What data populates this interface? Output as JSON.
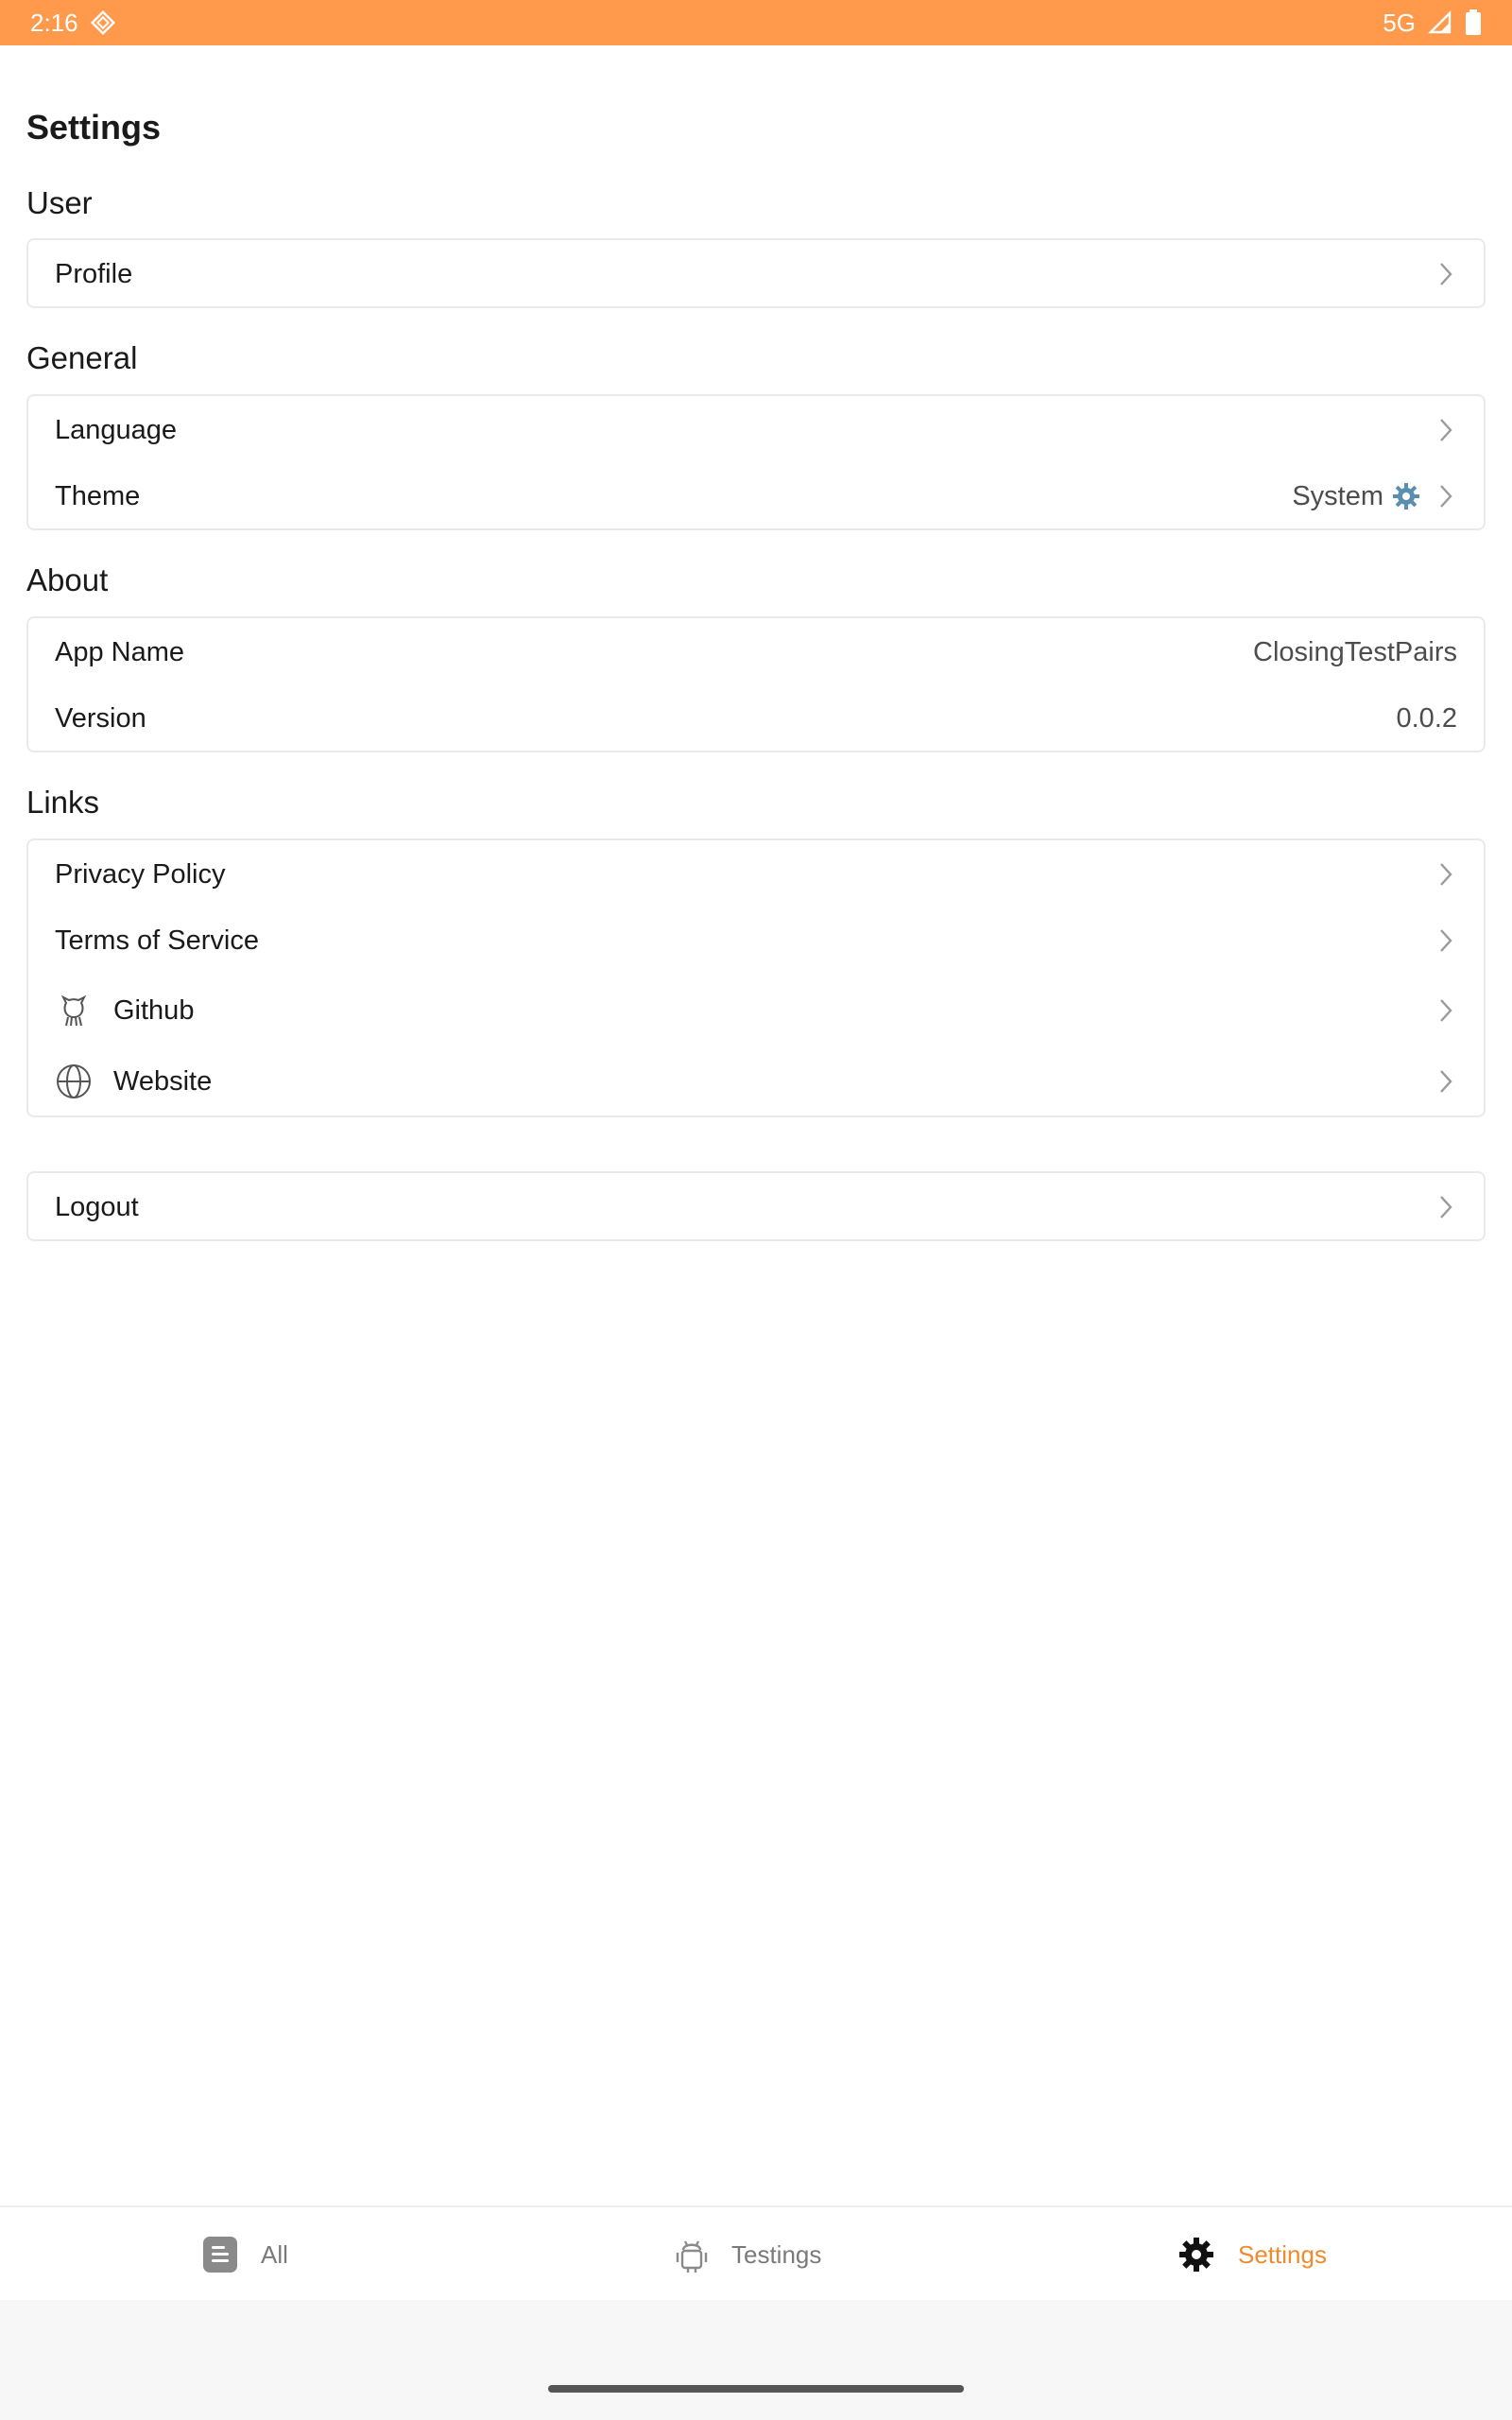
{
  "status_bar": {
    "time": "2:16",
    "network": "5G"
  },
  "page": {
    "title": "Settings"
  },
  "sections": {
    "user": {
      "title": "User",
      "items": [
        {
          "label": "Profile"
        }
      ]
    },
    "general": {
      "title": "General",
      "items": [
        {
          "label": "Language"
        },
        {
          "label": "Theme",
          "value": "System"
        }
      ]
    },
    "about": {
      "title": "About",
      "items": [
        {
          "label": "App Name",
          "value": "ClosingTestPairs"
        },
        {
          "label": "Version",
          "value": "0.0.2"
        }
      ]
    },
    "links": {
      "title": "Links",
      "items": [
        {
          "label": "Privacy Policy"
        },
        {
          "label": "Terms of Service"
        },
        {
          "label": "Github",
          "icon": "github-icon"
        },
        {
          "label": "Website",
          "icon": "globe-icon"
        }
      ]
    },
    "logout": {
      "items": [
        {
          "label": "Logout"
        }
      ]
    }
  },
  "bottom_nav": {
    "items": [
      {
        "label": "All",
        "icon": "list-icon",
        "active": false
      },
      {
        "label": "Testings",
        "icon": "android-icon",
        "active": false
      },
      {
        "label": "Settings",
        "icon": "gear-icon",
        "active": true
      }
    ]
  },
  "colors": {
    "accent": "#FF9A4D",
    "active_nav": "#F08A2D",
    "gear_blue": "#5B8FB0"
  }
}
